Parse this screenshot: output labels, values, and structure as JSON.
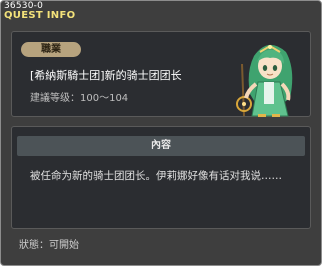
{
  "window": {
    "id_line": "36530-0",
    "title": "QUEST INFO"
  },
  "quest": {
    "role_badge": "職業",
    "name": "[希納斯騎士团]新的骑士团团长",
    "level": "建議等级：100～104"
  },
  "content": {
    "header": "內容",
    "body": "被任命为新的骑士团团长。伊莉娜好像有话对我说……"
  },
  "status": {
    "label": "狀態：可開始"
  },
  "colors": {
    "title": "#f3e27a",
    "badge_bg": "#b7a37e",
    "panel_bg": "#2b2d31",
    "window_bg": "#3e3e3e"
  },
  "icons": {
    "portrait": "npc-portrait-icon"
  }
}
